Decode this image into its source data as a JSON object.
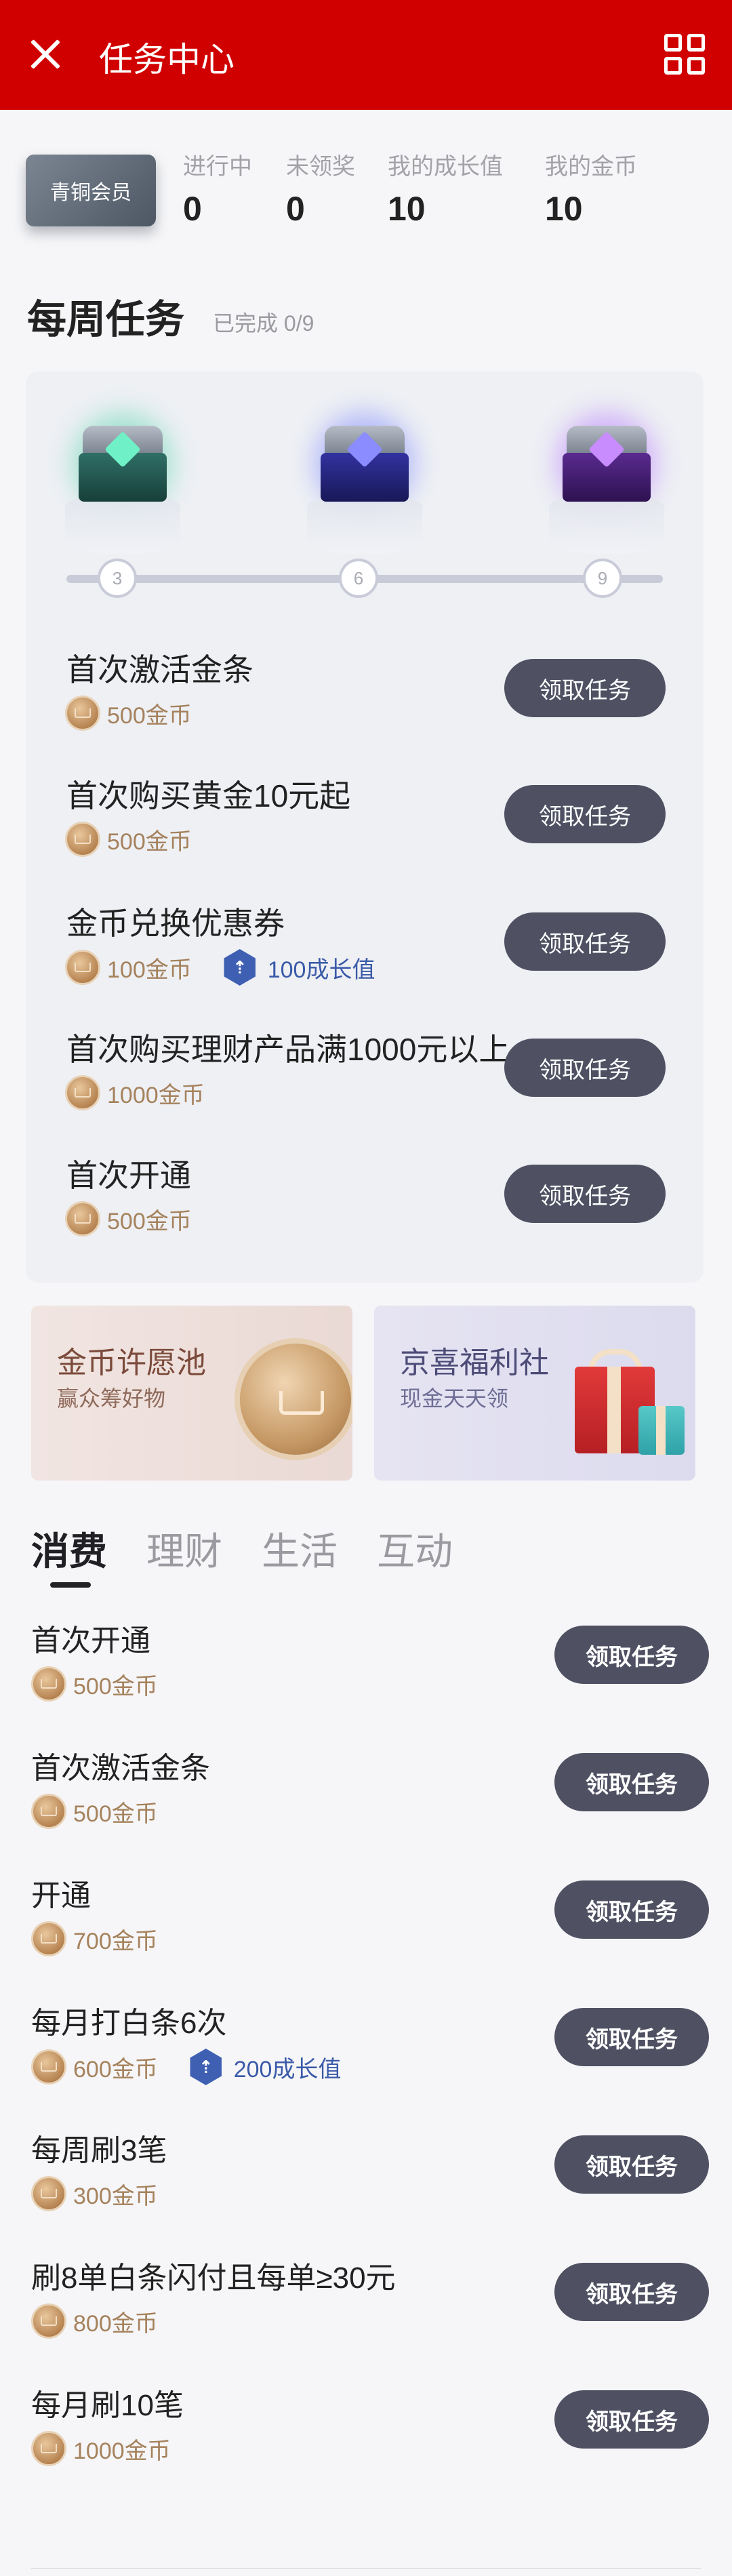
{
  "header": {
    "title": "任务中心",
    "close_icon": "close-icon",
    "menu_icon": "grid-icon",
    "bg_color": "#d10000"
  },
  "member": {
    "level": "青铜会员"
  },
  "stats": [
    {
      "label": "进行中",
      "value": "0"
    },
    {
      "label": "未领奖",
      "value": "0"
    },
    {
      "label": "我的成长值",
      "value": "10"
    },
    {
      "label": "我的金币",
      "value": "10"
    }
  ],
  "weekly": {
    "title": "每周任务",
    "progress_text": "已完成 0/9",
    "milestones": [
      "3",
      "6",
      "9"
    ],
    "tasks": [
      {
        "name": "首次激活金条",
        "coins": "500金币",
        "growth": "",
        "button": "领取任务"
      },
      {
        "name": "首次购买黄金10元起",
        "coins": "500金币",
        "growth": "",
        "button": "领取任务"
      },
      {
        "name": "金币兑换优惠券",
        "coins": "100金币",
        "growth": "100成长值",
        "button": "领取任务"
      },
      {
        "name": "首次购买理财产品满1000元以上",
        "coins": "1000金币",
        "growth": "",
        "button": "领取任务"
      },
      {
        "name": "首次开通",
        "coins": "500金币",
        "growth": "",
        "button": "领取任务"
      }
    ]
  },
  "promos": [
    {
      "title": "金币许愿池",
      "subtitle": "赢众筹好物"
    },
    {
      "title": "京喜福利社",
      "subtitle": "现金天天领"
    }
  ],
  "tabs": [
    "消费",
    "理财",
    "生活",
    "互动"
  ],
  "active_tab": "消费",
  "list": [
    {
      "name": "首次开通",
      "coins": "500金币",
      "growth": "",
      "button": "领取任务"
    },
    {
      "name": "首次激活金条",
      "coins": "500金币",
      "growth": "",
      "button": "领取任务"
    },
    {
      "name": "开通",
      "coins": "700金币",
      "growth": "",
      "button": "领取任务"
    },
    {
      "name": "每月打白条6次",
      "coins": "600金币",
      "growth": "200成长值",
      "button": "领取任务"
    },
    {
      "name": "每周刷3笔",
      "coins": "300金币",
      "growth": "",
      "button": "领取任务"
    },
    {
      "name": "刷8单白条闪付且每单≥30元",
      "coins": "800金币",
      "growth": "",
      "button": "领取任务"
    },
    {
      "name": "每月刷10笔",
      "coins": "1000金币",
      "growth": "",
      "button": "领取任务"
    }
  ],
  "colors": {
    "button": "#4f5163",
    "coin_text": "#a5825d",
    "growth_text": "#3a5aa8"
  }
}
